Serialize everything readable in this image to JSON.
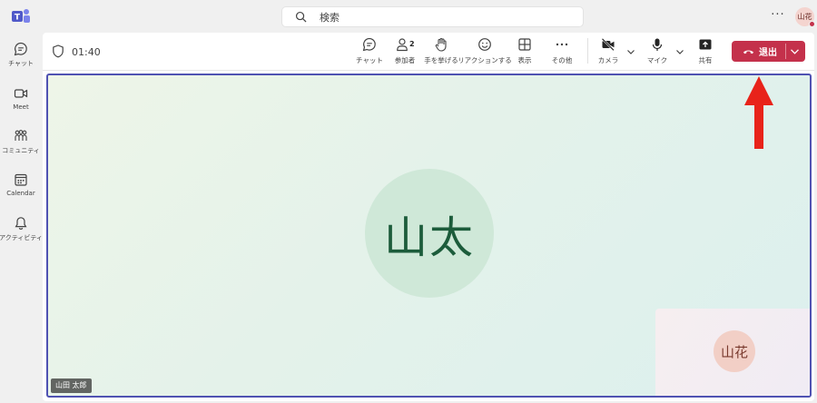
{
  "search": {
    "placeholder": "検索"
  },
  "header": {
    "more": "···",
    "user_initials": "山花"
  },
  "rail": {
    "items": [
      {
        "label": "チャット",
        "icon": "chat-icon"
      },
      {
        "label": "Meet",
        "icon": "video-icon"
      },
      {
        "label": "コミュニティ",
        "icon": "community-icon"
      },
      {
        "label": "Calendar",
        "icon": "calendar-icon"
      },
      {
        "label": "アクティビティ",
        "icon": "bell-icon"
      }
    ]
  },
  "meeting": {
    "timer": "01:40",
    "toolbar": {
      "chat": "チャット",
      "participants": "参加者",
      "participants_count": "2",
      "raise_hand": "手を挙げる",
      "reactions": "リアクションする",
      "view": "表示",
      "more": "その他",
      "camera": "カメラ",
      "mic": "マイク",
      "share": "共有",
      "leave": "退出"
    },
    "main_participant": {
      "initials": "山太",
      "name": "山田 太郎"
    },
    "self_view": {
      "initials": "山花"
    }
  },
  "colors": {
    "leave_red": "#c4314b",
    "stage_border": "#4f52b2",
    "annotation_arrow": "#e8231a"
  }
}
